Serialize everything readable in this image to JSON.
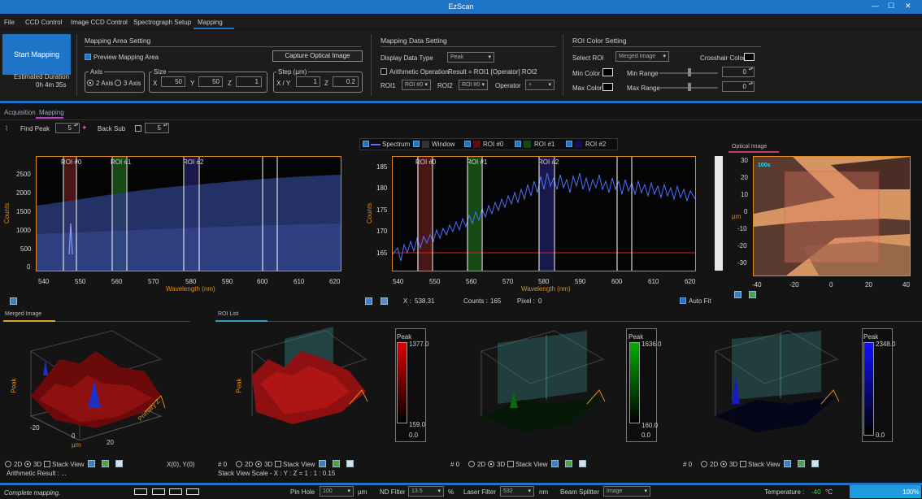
{
  "app": {
    "title": "EzScan",
    "win_buttons": [
      "—",
      "☐",
      "✕"
    ]
  },
  "menu": [
    "File",
    "CCD Control",
    "Image CCD Control",
    "Spectrograph Setup",
    "Mapping"
  ],
  "start_mapping": "Start Mapping",
  "estimated": {
    "label": "Estimated Duration",
    "value": "0h 4m 35s"
  },
  "mapping_area": {
    "title": "Mapping Area Setting",
    "preview_label": "Preview Mapping Area",
    "capture_button": "Capture Optical Image",
    "axis_title": "Axis",
    "axis_opt1": "2 Axis",
    "axis_opt2": "3 Axis",
    "size_title": "Size",
    "x_label": "X",
    "x_value": "50",
    "y_label": "Y",
    "y_value": "50",
    "z_label": "Z",
    "z_value": "1",
    "step_title": "Step (µm)",
    "xy_label": "X / Y",
    "xy_value": "1",
    "sz_label": "Z",
    "sz_value": "0.2"
  },
  "mapping_data": {
    "title": "Mapping Data Setting",
    "display_label": "Display Data Type",
    "display_value": "Peak",
    "arith_label": "Arithmetic Operation",
    "result_text": "Result = ROI1 [Operator] ROI2",
    "roi1_label": "ROI1",
    "roi1_value": "ROI #0",
    "roi2_label": "ROI2",
    "roi2_value": "ROI #0",
    "operator_label": "Operator",
    "operator_value": "+"
  },
  "roi_color": {
    "title": "ROI Color Setting",
    "select_label": "Select ROI",
    "select_value": "Merged Image",
    "crosshair_label": "Crosshair Color",
    "min_color": "Min Color",
    "max_color": "Max Color",
    "min_range": "Min Range",
    "min_range_value": "0",
    "max_range": "Max Range",
    "max_range_value": "0"
  },
  "sub_tabs": [
    "Acquisition",
    "Mapping"
  ],
  "find_peak": {
    "label": "Find Peak",
    "value": "5",
    "back_sub": "Back Sub",
    "back_value": "5"
  },
  "legend": [
    "Spectrum",
    "Window",
    "ROI #0",
    "ROI #1",
    "ROI #2"
  ],
  "plot_left": {
    "yticks": [
      "2500",
      "2000",
      "1500",
      "1000",
      "500",
      "0"
    ],
    "xticks": [
      "540",
      "550",
      "560",
      "570",
      "580",
      "590",
      "600",
      "610",
      "620"
    ],
    "xlabel": "Wavelength (nm)",
    "ylabel": "Counts",
    "roi_labels": [
      "ROI #0",
      "ROI #1",
      "ROI #2"
    ]
  },
  "plot_mid": {
    "yticks": [
      "185",
      "180",
      "175",
      "170",
      "165"
    ],
    "xticks": [
      "540",
      "550",
      "560",
      "570",
      "580",
      "590",
      "600",
      "610",
      "620"
    ],
    "xlabel": "Wavelength (nm)",
    "ylabel": "Counts",
    "roi_labels": [
      "ROI #0",
      "ROI #1",
      "ROI #2"
    ]
  },
  "readout": {
    "x_label": "X :",
    "x_value": "538.31",
    "counts_label": "Counts :",
    "counts_value": "165",
    "pixel_label": "Pixel :",
    "pixel_value": "0",
    "autofit": "Auto Fit"
  },
  "optical": {
    "tab": "Optical Image",
    "badge": "100x",
    "yticks": [
      "30",
      "20",
      "10",
      "0",
      "-10",
      "-20",
      "-30"
    ],
    "xticks": [
      "-40",
      "-20",
      "0",
      "20",
      "40"
    ],
    "ylabel": "µm"
  },
  "merged": {
    "tab": "Merged Image",
    "zlabel": "Peak",
    "depth_label": "Primary Z",
    "xticks": [
      "-20",
      "0",
      "20"
    ],
    "unit": "µm",
    "opt2d": "2D",
    "opt3d": "3D",
    "stack": "Stack View",
    "coord": "X(0), Y(0)",
    "arith": "Arithmetic Result :  ..."
  },
  "roi_list": {
    "tab": "ROI List",
    "scale_text": "Stack View Scale - X : Y : Z = 1 : 1 : 0.15",
    "panels": [
      {
        "id": "# 0",
        "title": "Peak",
        "max": "1377.0",
        "min": "159.0",
        "zero": "0.0",
        "color": "#e00000"
      },
      {
        "id": "# 0",
        "title": "Peak",
        "max": "1636.0",
        "min": "160.0",
        "zero": "0.0",
        "color": "#00b000"
      },
      {
        "id": "# 0",
        "title": "Peak",
        "max": "2348.0",
        "min": "",
        "zero": "0.0",
        "color": "#1010ff"
      }
    ]
  },
  "status": {
    "message": "Complete mapping.",
    "pinhole_label": "Pin Hole",
    "pinhole_value": "100",
    "pinhole_unit": "µm",
    "nd_label": "ND Filter",
    "nd_value": "13.5",
    "nd_unit": "%",
    "laser_label": "Laser Filter",
    "laser_value": "532",
    "laser_unit": "nm",
    "splitter_label": "Beam Splitter",
    "splitter_value": "Image",
    "temp_label": "Temperature :",
    "temp_value": "-40",
    "temp_unit": "°C",
    "progress": "100%"
  },
  "colors": {
    "accent": "#1e74c6",
    "axis": "#e08a1e",
    "spectrum": "#4f6fff"
  }
}
